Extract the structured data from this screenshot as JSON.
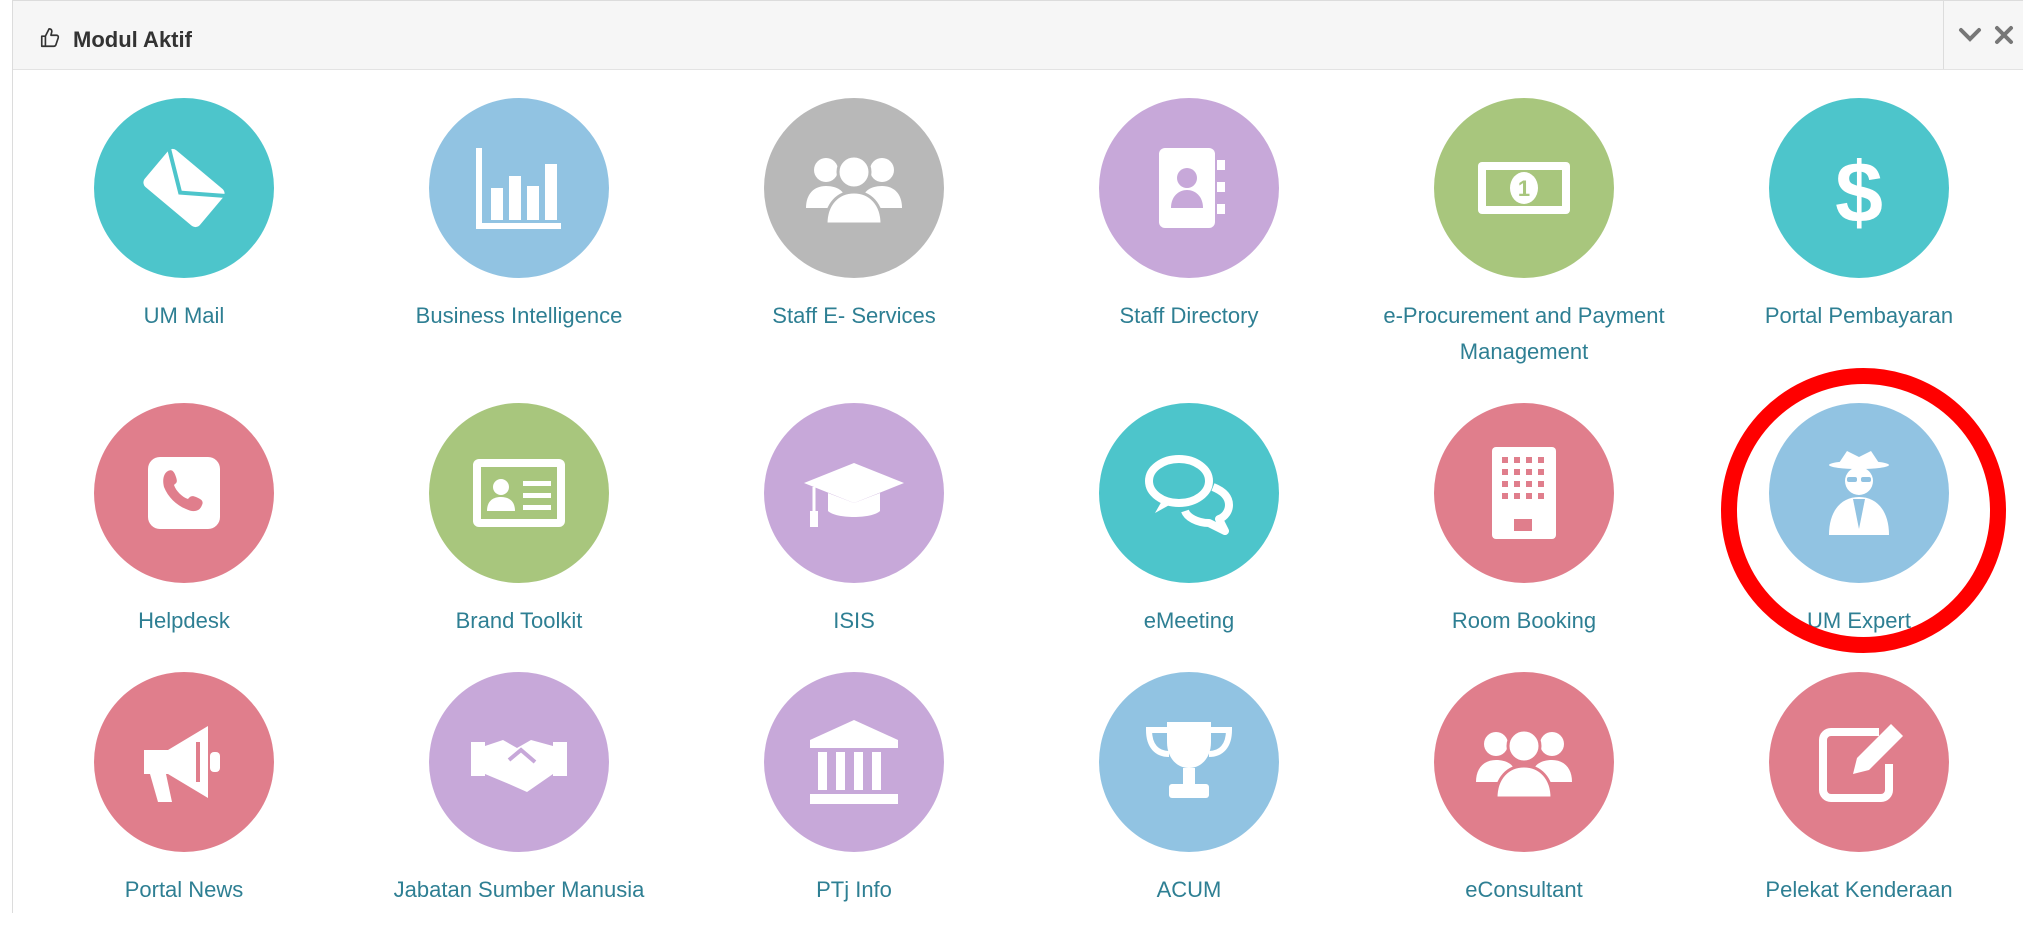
{
  "panel": {
    "title": "Modul Aktif"
  },
  "modules": [
    {
      "label": "UM Mail",
      "color": "#4dc5cb",
      "icon": "envelope-icon"
    },
    {
      "label": "Business Intelligence",
      "color": "#91c3e2",
      "icon": "bar-chart-icon"
    },
    {
      "label": "Staff E- Services",
      "color": "#b8b8b8",
      "icon": "users-icon"
    },
    {
      "label": "Staff Directory",
      "color": "#c7a8d9",
      "icon": "address-book-icon"
    },
    {
      "label": "e-Procurement and Payment Management",
      "color": "#a8c67d",
      "icon": "money-icon"
    },
    {
      "label": "Portal Pembayaran",
      "color": "#4dc5cb",
      "icon": "dollar-icon"
    },
    {
      "label": "Helpdesk",
      "color": "#e07e8c",
      "icon": "phone-icon"
    },
    {
      "label": "Brand Toolkit",
      "color": "#a8c67d",
      "icon": "id-card-icon"
    },
    {
      "label": "ISIS",
      "color": "#c7a8d9",
      "icon": "graduation-cap-icon"
    },
    {
      "label": "eMeeting",
      "color": "#4dc5cb",
      "icon": "comments-icon"
    },
    {
      "label": "Room Booking",
      "color": "#e07e8c",
      "icon": "building-icon"
    },
    {
      "label": "UM Expert",
      "color": "#91c3e2",
      "icon": "user-secret-icon"
    },
    {
      "label": "Portal News",
      "color": "#e07e8c",
      "icon": "bullhorn-icon"
    },
    {
      "label": "Jabatan Sumber Manusia",
      "color": "#c7a8d9",
      "icon": "handshake-icon"
    },
    {
      "label": "PTj Info",
      "color": "#c7a8d9",
      "icon": "university-icon"
    },
    {
      "label": "ACUM",
      "color": "#91c3e2",
      "icon": "trophy-icon"
    },
    {
      "label": "eConsultant",
      "color": "#e07e8c",
      "icon": "users-icon"
    },
    {
      "label": "Pelekat Kenderaan",
      "color": "#e07e8c",
      "icon": "edit-icon"
    }
  ],
  "annotation_color": "#ff0000"
}
